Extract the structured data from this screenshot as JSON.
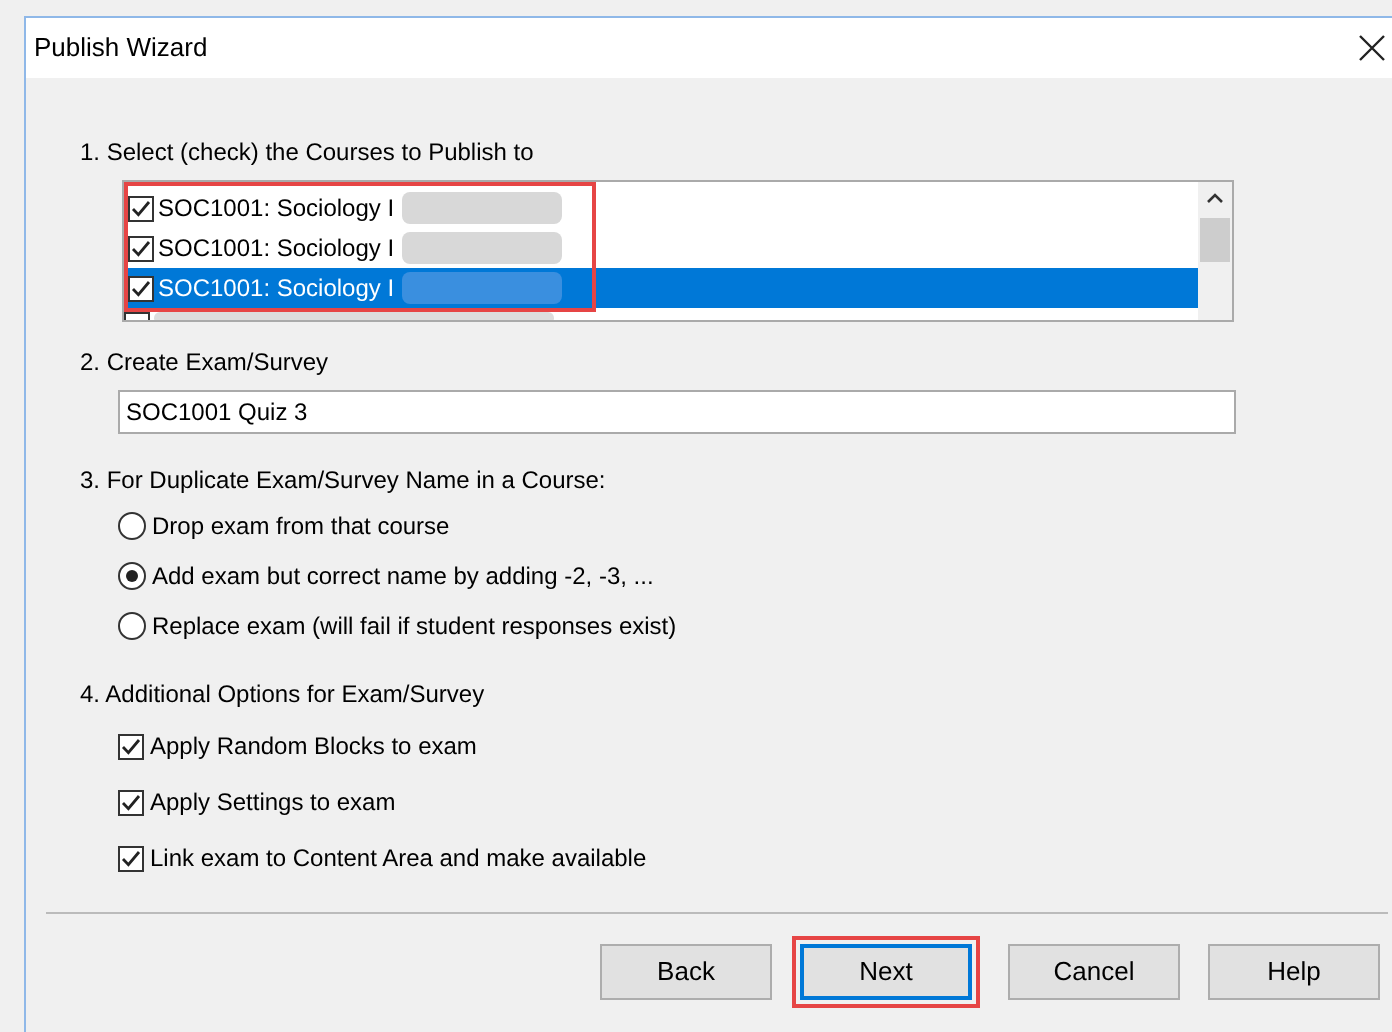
{
  "window": {
    "title": "Publish Wizard"
  },
  "steps": [
    {
      "label": "1.  Select (check) the Courses to Publish to"
    },
    {
      "label": "2.  Create Exam/Survey"
    },
    {
      "label": "3.  For Duplicate Exam/Survey Name in a Course:"
    },
    {
      "label": "4.  Additional Options for Exam/Survey"
    }
  ],
  "courses": [
    {
      "label": "SOC1001: Sociology I",
      "checked": true,
      "selected": false
    },
    {
      "label": "SOC1001: Sociology I",
      "checked": true,
      "selected": false
    },
    {
      "label": "SOC1001: Sociology I",
      "checked": true,
      "selected": true
    }
  ],
  "partial_course": {
    "checked": false
  },
  "exam_name": {
    "value": "SOC1001 Quiz 3"
  },
  "duplicate_options": [
    {
      "label": "Drop exam from that course",
      "selected": false
    },
    {
      "label": "Add exam but correct name by adding -2, -3, ...",
      "selected": true
    },
    {
      "label": "Replace exam (will fail if student responses exist)",
      "selected": false
    }
  ],
  "additional_options": [
    {
      "label": "Apply Random Blocks to exam",
      "checked": true
    },
    {
      "label": "Apply Settings to exam",
      "checked": true
    },
    {
      "label": "Link exam to Content Area and make available",
      "checked": true
    }
  ],
  "buttons": [
    {
      "label": "Back",
      "focused": false
    },
    {
      "label": "Next",
      "focused": true
    },
    {
      "label": "Cancel",
      "focused": false
    },
    {
      "label": "Help",
      "focused": false
    }
  ]
}
